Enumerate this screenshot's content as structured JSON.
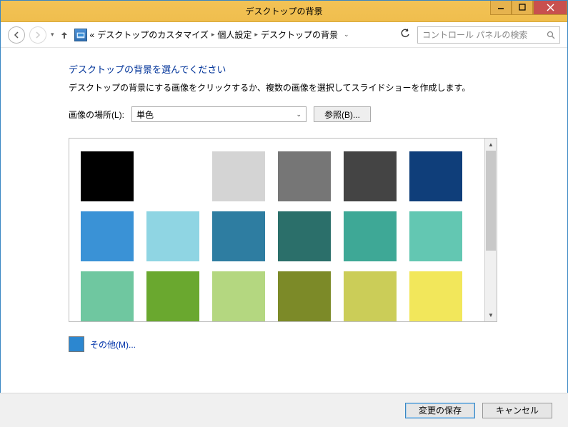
{
  "titlebar": {
    "title": "デスクトップの背景"
  },
  "nav": {
    "crumb_prefix": "«",
    "crumb1": "デスクトップのカスタマイズ",
    "crumb2": "個人設定",
    "crumb3": "デスクトップの背景",
    "search_placeholder": "コントロール パネルの検索"
  },
  "main": {
    "heading": "デスクトップの背景を選んでください",
    "subtext": "デスクトップの背景にする画像をクリックするか、複数の画像を選択してスライドショーを作成します。",
    "location_label": "画像の場所(L):",
    "location_value": "単色",
    "browse_label": "参照(B)...",
    "other_label": "その他(M)...",
    "other_color": "#2c87d0"
  },
  "colors": [
    "#000000",
    "#ffffff",
    "#d4d4d4",
    "#767676",
    "#444444",
    "#0f3e7a",
    "#3a92d6",
    "#8fd5e3",
    "#2e7da1",
    "#2b6f6a",
    "#3ea896",
    "#63c7b2",
    "#6fc7a0",
    "#6aa82f",
    "#b4d780",
    "#7c8a28",
    "#cbcd58",
    "#f2e75b"
  ],
  "footer": {
    "save": "変更の保存",
    "cancel": "キャンセル"
  }
}
